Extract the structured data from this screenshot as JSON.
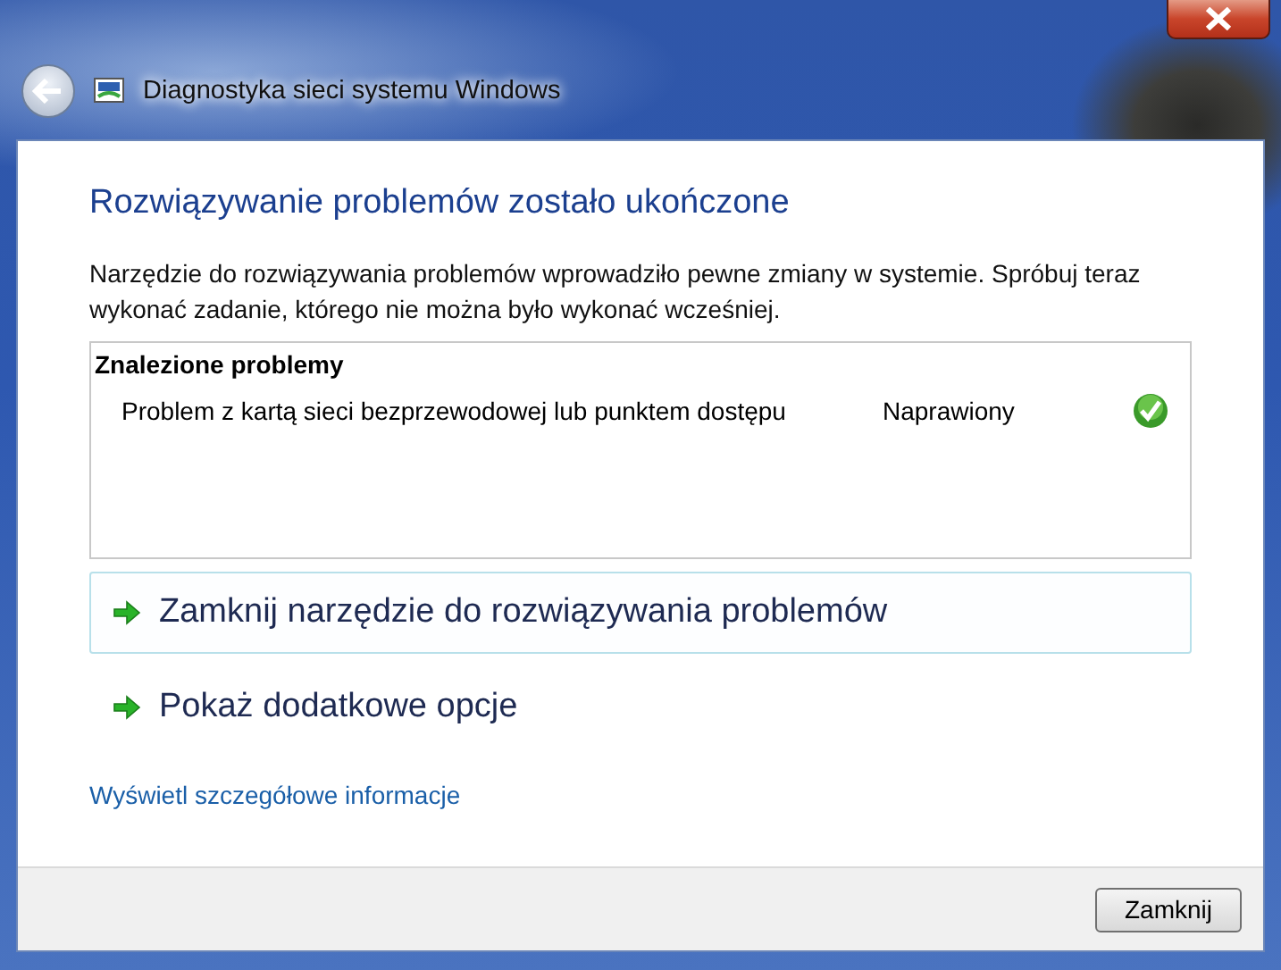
{
  "window": {
    "title": "Diagnostyka sieci systemu Windows"
  },
  "heading": "Rozwiązywanie problemów zostało ukończone",
  "description": "Narzędzie do rozwiązywania problemów wprowadziło pewne zmiany w systemie. Spróbuj teraz wykonać zadanie, którego nie można było wykonać wcześniej.",
  "problems": {
    "title": "Znalezione problemy",
    "rows": [
      {
        "name": "Problem z kartą sieci bezprzewodowej lub punktem dostępu",
        "status": "Naprawiony",
        "fixed": true
      }
    ]
  },
  "actions": [
    {
      "label": "Zamknij narzędzie do rozwiązywania problemów",
      "highlighted": true
    },
    {
      "label": "Pokaż dodatkowe opcje",
      "highlighted": false
    }
  ],
  "details_link": "Wyświetl szczegółowe informacje",
  "buttons": [
    "Zamknij"
  ]
}
